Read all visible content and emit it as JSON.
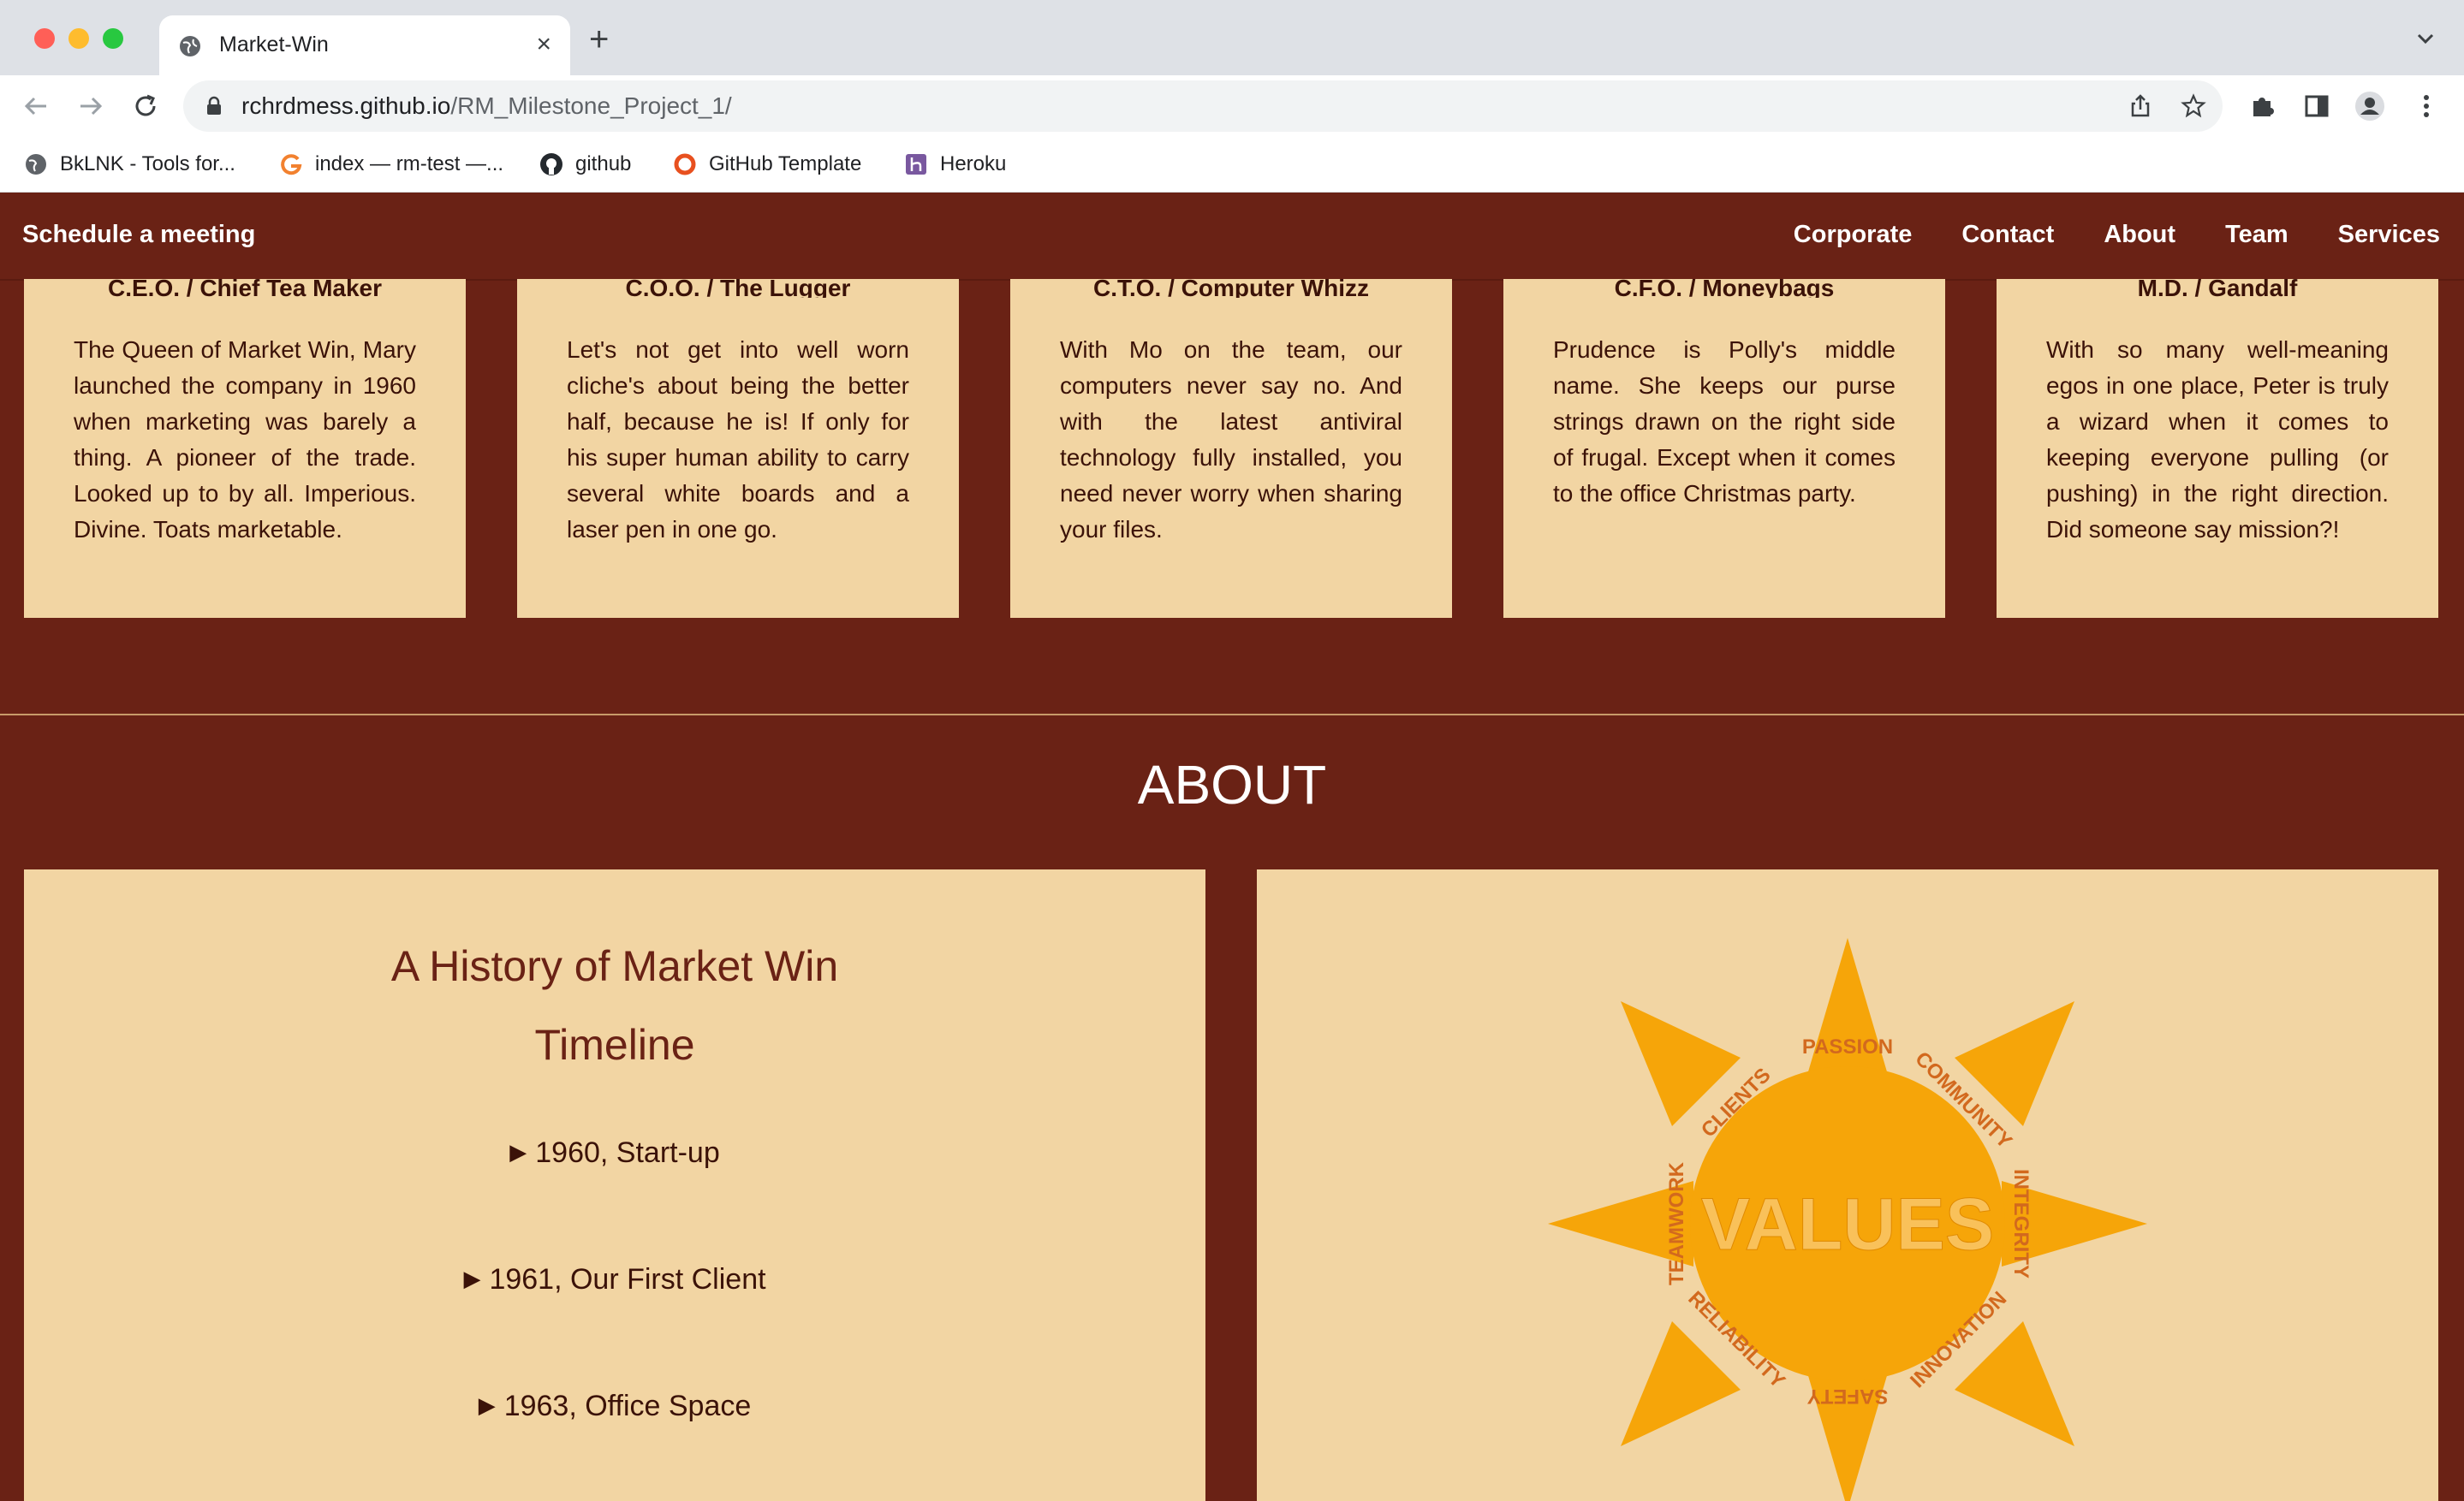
{
  "browser": {
    "tab_title": "Market-Win",
    "url_host": "rchrdmess.github.io",
    "url_path": "/RM_Milestone_Project_1/",
    "bookmarks": [
      {
        "label": "BkLNK - Tools for...",
        "icon": "globe-icon"
      },
      {
        "label": "index — rm-test —...",
        "icon": "codepen-g-icon"
      },
      {
        "label": "github",
        "icon": "github-icon"
      },
      {
        "label": "GitHub Template",
        "icon": "circle-o-icon"
      },
      {
        "label": "Heroku",
        "icon": "heroku-icon"
      }
    ]
  },
  "site_nav": {
    "cta": "Schedule a meeting",
    "links": [
      "Corporate",
      "Contact",
      "About",
      "Team",
      "Services"
    ]
  },
  "team": [
    {
      "title": "C.E.O. / Chief Tea Maker",
      "bio": "The Queen of Market Win, Mary launched the company in 1960 when marketing was barely a thing. A pioneer of the trade. Looked up to by all. Imperious. Divine. Toats marketable."
    },
    {
      "title": "C.O.O. / The Lugger",
      "bio": "Let's not get into well worn cliche's about being the better half, because he is! If only for his super human ability to carry several white boards and a laser pen in one go."
    },
    {
      "title": "C.T.O. / Computer Whizz",
      "bio": "With Mo on the team, our computers never say no. And with the latest antiviral technology fully installed, you need never worry when sharing your files."
    },
    {
      "title": "C.F.O. / Moneybags",
      "bio": "Prudence is Polly's middle name. She keeps our purse strings drawn on the right side of frugal. Except when it comes to the office Christmas party."
    },
    {
      "title": "M.D. / Gandalf",
      "bio": "With so many well-meaning egos in one place, Peter is truly a wizard when it comes to keeping everyone pulling (or pushing) in the right direction. Did someone say mission?!"
    }
  ],
  "about": {
    "heading": "ABOUT",
    "history_title": "A History of Market Win",
    "timeline_title": "Timeline",
    "timeline": [
      "1960, Start-up",
      "1961, Our First Client",
      "1963, Office Space"
    ],
    "values_image": {
      "center": "VALUES",
      "words": [
        "PASSION",
        "COMMUNITY",
        "INTEGRITY",
        "INNOVATION",
        "SAFETY",
        "RELIABILITY",
        "TEAMWORK",
        "CLIENTS"
      ],
      "sun_color": "#f6a509",
      "text_color": "#d2691e"
    }
  },
  "colors": {
    "brand_brown": "#6a2215",
    "card_beige": "#f2d5a3"
  }
}
